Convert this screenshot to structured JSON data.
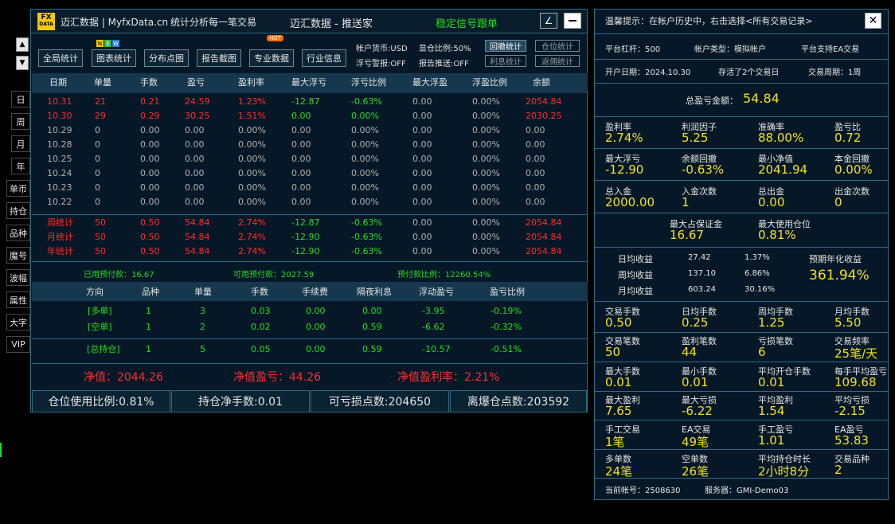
{
  "left": {
    "buttons": [
      "日",
      "周",
      "月",
      "年",
      "单币",
      "持仓",
      "品种",
      "魔号",
      "波幅",
      "属性",
      "大字",
      "VIP"
    ]
  },
  "title": {
    "logo_top": "FX",
    "logo_bottom": "DATA",
    "brand": "迈汇数据 | MyfxData.cn",
    "slogan": "统计分析每一笔交易",
    "center": "迈汇数据 - 推送家",
    "signal": "稳定信号跟单"
  },
  "toolbar": {
    "badge_new": [
      "N",
      "E",
      "W"
    ],
    "badge_hot": "HOT",
    "buttons": [
      "全局统计",
      "图表统计",
      "分布点图",
      "报告截图",
      "专业数据",
      "行业信息"
    ],
    "options": {
      "currency": "帐户货币:USD",
      "display_ratio": "显仓比例:50%",
      "float_warn": "浮亏警报:OFF",
      "report_push": "报告推送:OFF"
    },
    "small_buttons": [
      "回撤统计",
      "仓位统计",
      "利息统计",
      "返佣统计"
    ]
  },
  "daily": {
    "headers": [
      "日期",
      "单量",
      "手数",
      "盈亏",
      "盈利率",
      "最大浮亏",
      "浮亏比例",
      "最大浮盈",
      "浮盈比例",
      "余额"
    ],
    "rows": [
      [
        "10.31",
        "21",
        "0.21",
        "24.59",
        "1.23%",
        "-12.87",
        "-0.63%",
        "0.00",
        "0.00%",
        "2054.84"
      ],
      [
        "10.30",
        "29",
        "0.29",
        "30.25",
        "1.51%",
        "0.00",
        "0.00%",
        "0.00",
        "0.00%",
        "2030.25"
      ],
      [
        "10.29",
        "0",
        "0.00",
        "0.00",
        "0.00%",
        "0.00",
        "0.00%",
        "0.00",
        "0.00%",
        "0.00"
      ],
      [
        "10.28",
        "0",
        "0.00",
        "0.00",
        "0.00%",
        "0.00",
        "0.00%",
        "0.00",
        "0.00%",
        "0.00"
      ],
      [
        "10.25",
        "0",
        "0.00",
        "0.00",
        "0.00%",
        "0.00",
        "0.00%",
        "0.00",
        "0.00%",
        "0.00"
      ],
      [
        "10.24",
        "0",
        "0.00",
        "0.00",
        "0.00%",
        "0.00",
        "0.00%",
        "0.00",
        "0.00%",
        "0.00"
      ],
      [
        "10.23",
        "0",
        "0.00",
        "0.00",
        "0.00%",
        "0.00",
        "0.00%",
        "0.00",
        "0.00%",
        "0.00"
      ],
      [
        "10.22",
        "0",
        "0.00",
        "0.00",
        "0.00%",
        "0.00",
        "0.00%",
        "0.00",
        "0.00%",
        "0.00"
      ]
    ],
    "totals": [
      [
        "周统计",
        "50",
        "0.50",
        "54.84",
        "2.74%",
        "-12.87",
        "-0.63%",
        "0.00",
        "0.00%",
        "2054.84"
      ],
      [
        "月统计",
        "50",
        "0.50",
        "54.84",
        "2.74%",
        "-12.90",
        "-0.63%",
        "0.00",
        "0.00%",
        "2054.84"
      ],
      [
        "年统计",
        "50",
        "0.50",
        "54.84",
        "2.74%",
        "-12.90",
        "-0.63%",
        "0.00",
        "0.00%",
        "2054.84"
      ]
    ]
  },
  "margin": {
    "used": "已用预付款：16.67",
    "available": "可用预付款：2027.59",
    "ratio": "预付款比例：12260.54%"
  },
  "positions": {
    "headers": [
      "方向",
      "品种",
      "单量",
      "手数",
      "手续费",
      "隔夜利息",
      "浮动盈亏",
      "盈亏比例"
    ],
    "rows": [
      [
        "[多单]",
        "1",
        "3",
        "0.03",
        "0.00",
        "0.00",
        "-3.95",
        "-0.19%"
      ],
      [
        "[空单]",
        "1",
        "2",
        "0.02",
        "0.00",
        "0.59",
        "-6.62",
        "-0.32%"
      ]
    ],
    "total": [
      "[总持仓]",
      "1",
      "5",
      "0.05",
      "0.00",
      "0.59",
      "-10.57",
      "-0.51%"
    ]
  },
  "equity": {
    "net": "净值：2044.26",
    "pnl": "净值盈亏：44.26",
    "rate": "净值盈利率：2.21%"
  },
  "bottom": [
    "仓位使用比例:0.81%",
    "持仓净手数:0.01",
    "可亏损点数:204650",
    "离爆仓点数:203592"
  ],
  "right": {
    "tip": "温馨提示：在帐户历史中，右击选择<所有交易记录>",
    "row1": [
      "平台杠杆：500",
      "帐户类型：模拟帐户",
      "平台支持EA交易"
    ],
    "row2": [
      "开户日期：2024.10.30",
      "存活了2个交易日",
      "交易周期：1周"
    ],
    "total_pnl_label": "总盈亏金额：",
    "total_pnl": "54.84",
    "grid1": [
      {
        "label": "盈利率",
        "value": "2.74%"
      },
      {
        "label": "利润因子",
        "value": "5.25"
      },
      {
        "label": "准确率",
        "value": "88.00%"
      },
      {
        "label": "盈亏比",
        "value": "0.72"
      }
    ],
    "grid2": [
      {
        "label": "最大浮亏",
        "value": "-12.90"
      },
      {
        "label": "余额回撤",
        "value": "-0.63%"
      },
      {
        "label": "最小净值",
        "value": "2041.94"
      },
      {
        "label": "本金回撤",
        "value": "0.00%"
      }
    ],
    "grid3": [
      {
        "label": "总入金",
        "value": "2000.00"
      },
      {
        "label": "入金次数",
        "value": "1"
      },
      {
        "label": "总出金",
        "value": "0.00"
      },
      {
        "label": "出金次数",
        "value": "0"
      }
    ],
    "margin_max": {
      "label": "最大占保证金",
      "value": "16.67"
    },
    "pos_max": {
      "label": "最大使用仓位",
      "value": "0.81%"
    },
    "income": [
      [
        "日均收益",
        "27.42",
        "1.37%"
      ],
      [
        "周均收益",
        "137.10",
        "6.86%"
      ],
      [
        "月均收益",
        "603.24",
        "30.16%"
      ]
    ],
    "annual_label": "预期年化收益",
    "annual": "361.94%",
    "grid4": [
      {
        "label": "交易手数",
        "value": "0.50"
      },
      {
        "label": "日均手数",
        "value": "0.25"
      },
      {
        "label": "周均手数",
        "value": "1.25"
      },
      {
        "label": "月均手数",
        "value": "5.50"
      }
    ],
    "grid5": [
      {
        "label": "交易笔数",
        "value": "50"
      },
      {
        "label": "盈利笔数",
        "value": "44"
      },
      {
        "label": "亏损笔数",
        "value": "6"
      },
      {
        "label": "交易频率",
        "value": "25笔/天"
      }
    ],
    "grid6": [
      {
        "label": "最大手数",
        "value": "0.01"
      },
      {
        "label": "最小手数",
        "value": "0.01"
      },
      {
        "label": "平均开仓手数",
        "value": "0.01"
      },
      {
        "label": "每手平均盈亏",
        "value": "109.68"
      }
    ],
    "grid7": [
      {
        "label": "最大盈利",
        "value": "7.65"
      },
      {
        "label": "最大亏损",
        "value": "-6.22"
      },
      {
        "label": "平均盈利",
        "value": "1.54"
      },
      {
        "label": "平均亏损",
        "value": "-2.15"
      }
    ],
    "grid8": [
      {
        "label": "手工交易",
        "value": "1笔"
      },
      {
        "label": "EA交易",
        "value": "49笔"
      },
      {
        "label": "手工盈亏",
        "value": "1.01"
      },
      {
        "label": "EA盈亏",
        "value": "53.83"
      }
    ],
    "grid9": [
      {
        "label": "多单数",
        "value": "24笔"
      },
      {
        "label": "空单数",
        "value": "26笔"
      },
      {
        "label": "平均持仓时长",
        "value": "2小时8分"
      },
      {
        "label": "交易品种",
        "value": "2"
      }
    ],
    "account": "当前帐号：2508630",
    "server": "服务器：GMI-Demo03"
  }
}
